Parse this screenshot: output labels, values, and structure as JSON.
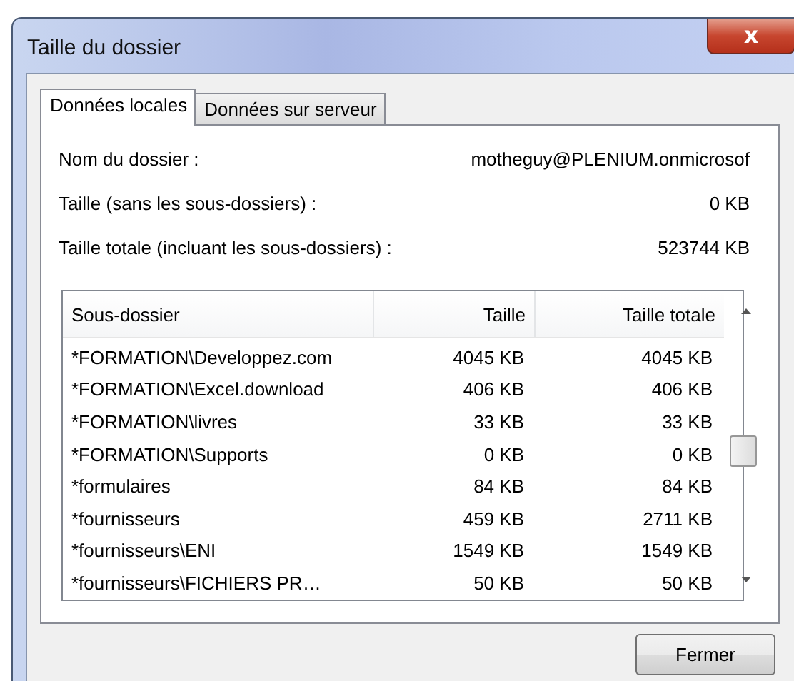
{
  "window": {
    "title": "Taille du dossier",
    "close": "x"
  },
  "tabs": [
    {
      "label": "Données locales",
      "selected": true
    },
    {
      "label": "Données sur serveur",
      "selected": false
    }
  ],
  "info": [
    {
      "label": "Nom du dossier :",
      "value": "motheguy@PLENIUM.onmicrosof"
    },
    {
      "label": "Taille (sans les sous-dossiers) :",
      "value": "0 KB"
    },
    {
      "label": "Taille totale (incluant les sous-dossiers) :",
      "value": "523744 KB"
    }
  ],
  "table": {
    "columns": [
      "Sous-dossier",
      "Taille",
      "Taille totale"
    ],
    "rows": [
      [
        "*FORMATION\\Developpez.com",
        "4045 KB",
        "4045 KB"
      ],
      [
        "*FORMATION\\Excel.download",
        "406 KB",
        "406 KB"
      ],
      [
        "*FORMATION\\livres",
        "33 KB",
        "33 KB"
      ],
      [
        "*FORMATION\\Supports",
        "0 KB",
        "0 KB"
      ],
      [
        "*formulaires",
        "84 KB",
        "84 KB"
      ],
      [
        "*fournisseurs",
        "459 KB",
        "2711 KB"
      ],
      [
        "*fournisseurs\\ENI",
        "1549 KB",
        "1549 KB"
      ],
      [
        "*fournisseurs\\FICHIERS PR…",
        "50 KB",
        "50 KB"
      ]
    ]
  },
  "buttons": [
    "Fermer"
  ]
}
